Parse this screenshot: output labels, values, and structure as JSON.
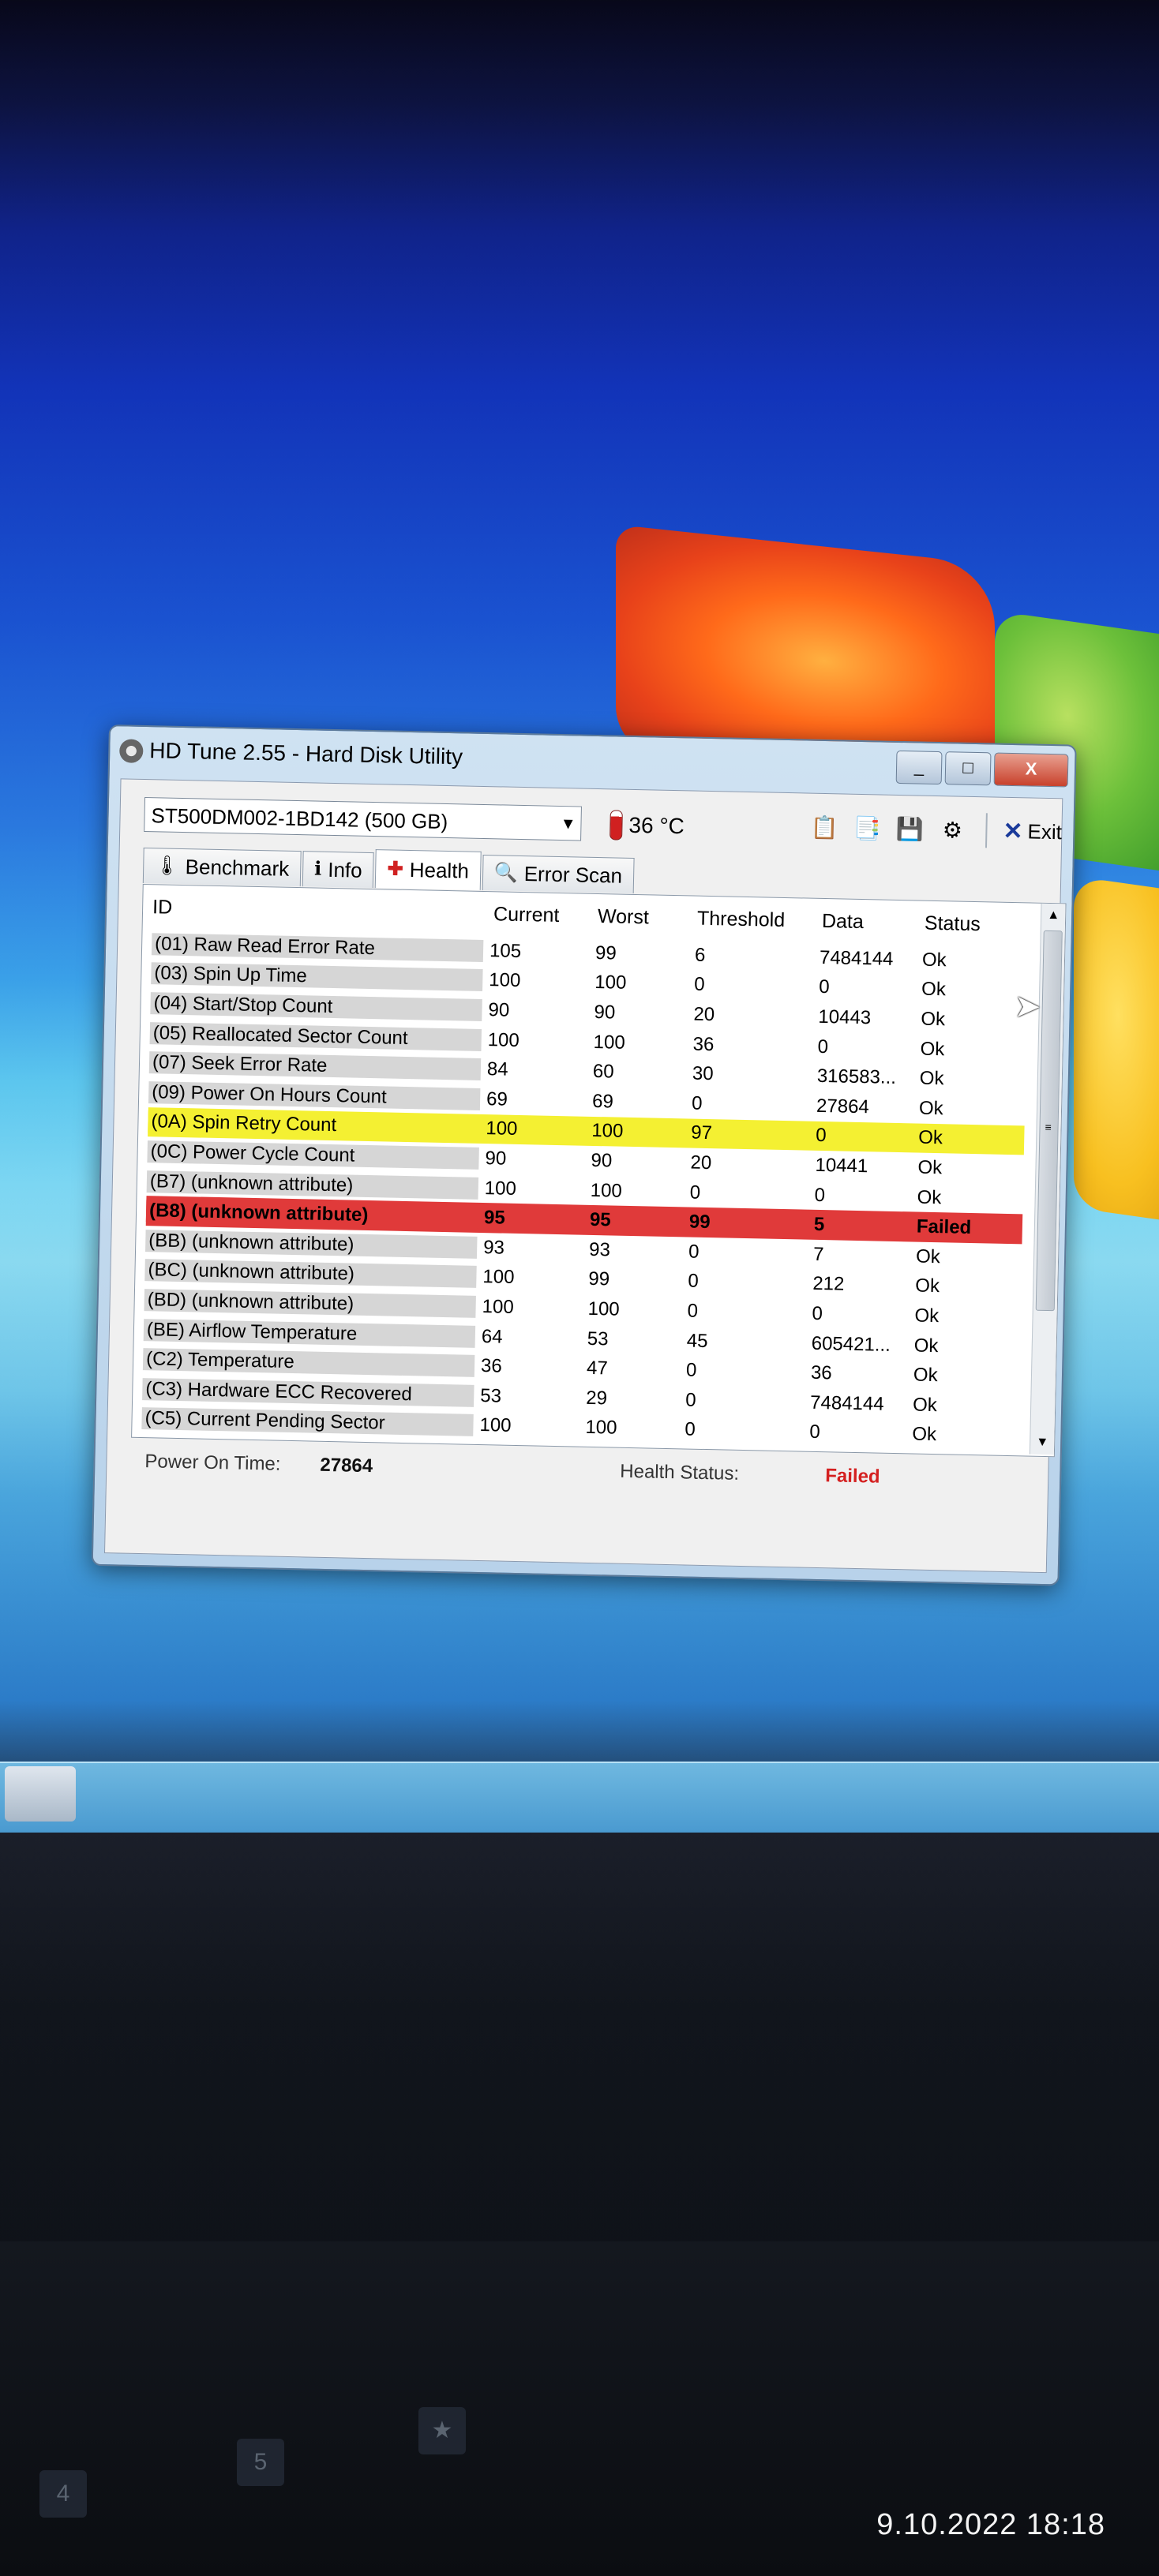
{
  "window": {
    "title": "HD Tune 2.55 - Hard Disk Utility",
    "close_label": "X",
    "min_label": "_",
    "max_label": "□"
  },
  "drive": {
    "selected": "ST500DM002-1BD142 (500 GB)",
    "temperature": "36 °C"
  },
  "toolbar": {
    "exit_label": "Exit",
    "buttons": [
      "copy-info",
      "copy-screenshot",
      "save",
      "options"
    ]
  },
  "tabs": [
    {
      "label": "Benchmark",
      "icon": "benchmark-icon"
    },
    {
      "label": "Info",
      "icon": "info-icon"
    },
    {
      "label": "Health",
      "icon": "health-icon",
      "active": true
    },
    {
      "label": "Error Scan",
      "icon": "error-scan-icon"
    }
  ],
  "table": {
    "headers": [
      "ID",
      "Current",
      "Worst",
      "Threshold",
      "Data",
      "Status"
    ],
    "rows": [
      {
        "id": "(01) Raw Read Error Rate",
        "current": "105",
        "worst": "99",
        "threshold": "6",
        "data": "7484144",
        "status": "Ok",
        "state": "ok"
      },
      {
        "id": "(03) Spin Up Time",
        "current": "100",
        "worst": "100",
        "threshold": "0",
        "data": "0",
        "status": "Ok",
        "state": "ok"
      },
      {
        "id": "(04) Start/Stop Count",
        "current": "90",
        "worst": "90",
        "threshold": "20",
        "data": "10443",
        "status": "Ok",
        "state": "ok"
      },
      {
        "id": "(05) Reallocated Sector Count",
        "current": "100",
        "worst": "100",
        "threshold": "36",
        "data": "0",
        "status": "Ok",
        "state": "ok"
      },
      {
        "id": "(07) Seek Error Rate",
        "current": "84",
        "worst": "60",
        "threshold": "30",
        "data": "316583...",
        "status": "Ok",
        "state": "ok"
      },
      {
        "id": "(09) Power On Hours Count",
        "current": "69",
        "worst": "69",
        "threshold": "0",
        "data": "27864",
        "status": "Ok",
        "state": "ok"
      },
      {
        "id": "(0A) Spin Retry Count",
        "current": "100",
        "worst": "100",
        "threshold": "97",
        "data": "0",
        "status": "Ok",
        "state": "warn"
      },
      {
        "id": "(0C) Power Cycle Count",
        "current": "90",
        "worst": "90",
        "threshold": "20",
        "data": "10441",
        "status": "Ok",
        "state": "ok"
      },
      {
        "id": "(B7) (unknown attribute)",
        "current": "100",
        "worst": "100",
        "threshold": "0",
        "data": "0",
        "status": "Ok",
        "state": "ok"
      },
      {
        "id": "(B8) (unknown attribute)",
        "current": "95",
        "worst": "95",
        "threshold": "99",
        "data": "5",
        "status": "Failed",
        "state": "fail"
      },
      {
        "id": "(BB) (unknown attribute)",
        "current": "93",
        "worst": "93",
        "threshold": "0",
        "data": "7",
        "status": "Ok",
        "state": "ok"
      },
      {
        "id": "(BC) (unknown attribute)",
        "current": "100",
        "worst": "99",
        "threshold": "0",
        "data": "212",
        "status": "Ok",
        "state": "ok"
      },
      {
        "id": "(BD) (unknown attribute)",
        "current": "100",
        "worst": "100",
        "threshold": "0",
        "data": "0",
        "status": "Ok",
        "state": "ok"
      },
      {
        "id": "(BE) Airflow Temperature",
        "current": "64",
        "worst": "53",
        "threshold": "45",
        "data": "605421...",
        "status": "Ok",
        "state": "ok"
      },
      {
        "id": "(C2) Temperature",
        "current": "36",
        "worst": "47",
        "threshold": "0",
        "data": "36",
        "status": "Ok",
        "state": "ok"
      },
      {
        "id": "(C3) Hardware ECC Recovered",
        "current": "53",
        "worst": "29",
        "threshold": "0",
        "data": "7484144",
        "status": "Ok",
        "state": "ok"
      },
      {
        "id": "(C5) Current Pending Sector",
        "current": "100",
        "worst": "100",
        "threshold": "0",
        "data": "0",
        "status": "Ok",
        "state": "ok"
      }
    ]
  },
  "status_bar": {
    "power_on_label": "Power On Time:",
    "power_on_value": "27864",
    "health_label": "Health Status:",
    "health_value": "Failed"
  },
  "photo": {
    "timestamp": "9.10.2022 18:18"
  },
  "keyboard": {
    "keys": [
      "4",
      "5",
      "★"
    ]
  },
  "colors": {
    "warn_row": "#f4f032",
    "fail_row": "#e03a3a",
    "failed_text": "#d42020"
  }
}
